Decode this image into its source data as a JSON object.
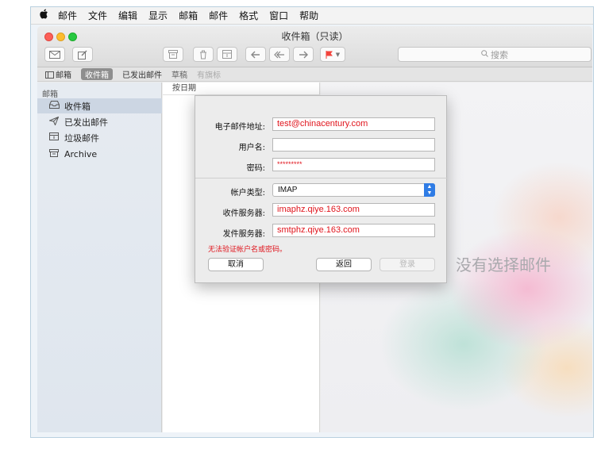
{
  "menubar": {
    "apple": "",
    "items": [
      "邮件",
      "文件",
      "编辑",
      "显示",
      "邮箱",
      "邮件",
      "格式",
      "窗口",
      "帮助"
    ]
  },
  "window": {
    "title": "收件箱（只读）",
    "search_placeholder": "搜索"
  },
  "favorites": {
    "mailbox": "邮箱",
    "inbox": "收件箱",
    "sent": "已发出邮件",
    "drafts": "草稿",
    "flagged": "有旗标"
  },
  "sidebar": {
    "header": "邮箱",
    "items": [
      {
        "label": "收件箱",
        "icon": "inbox-icon"
      },
      {
        "label": "已发出邮件",
        "icon": "paper-plane-icon"
      },
      {
        "label": "垃圾邮件",
        "icon": "junk-tray-icon"
      },
      {
        "label": "Archive",
        "icon": "archive-box-icon"
      }
    ]
  },
  "list": {
    "sort_label": "按日期"
  },
  "preview": {
    "no_message": "没有选择邮件"
  },
  "dialog": {
    "email_label": "电子邮件地址:",
    "email_value": "test@chinacentury.com",
    "username_label": "用户名:",
    "username_value": "",
    "password_label": "密码:",
    "password_value": "*********",
    "account_type_label": "帐户类型:",
    "account_type_value": "IMAP",
    "incoming_label": "收件服务器:",
    "incoming_value": "imaphz.qiye.163.com",
    "outgoing_label": "发件服务器:",
    "outgoing_value": "smtphz.qiye.163.com",
    "error": "无法验证帐户名或密码。",
    "cancel": "取消",
    "back": "返回",
    "login": "登录"
  },
  "colors": {
    "error_red": "#e0141c",
    "select_blue": "#2f7ce5",
    "traffic_close": "#fc5f57",
    "traffic_min": "#fdbc2e",
    "traffic_max": "#27c840",
    "flag_red": "#f2433b"
  }
}
